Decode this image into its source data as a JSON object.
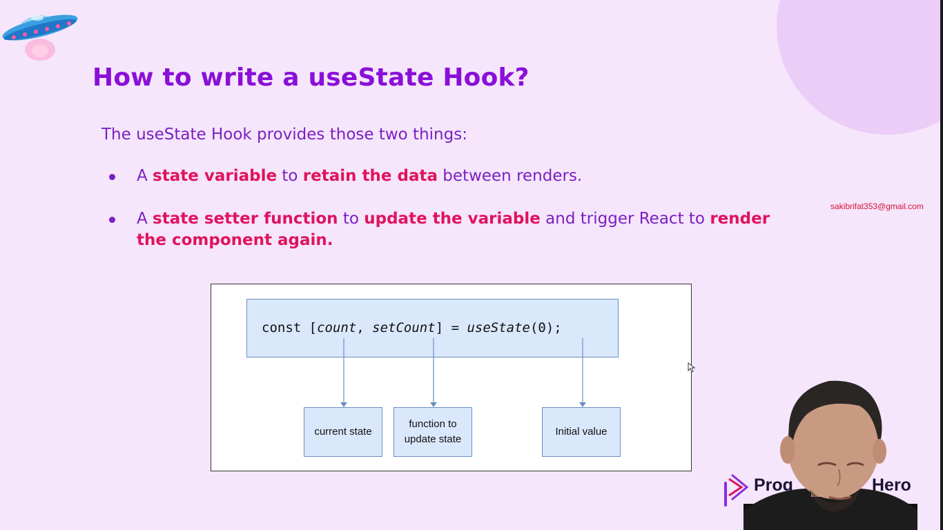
{
  "slide": {
    "title": "How to write a useState Hook?",
    "intro": "The useState Hook provides those two things:",
    "bullets": [
      {
        "parts": [
          "A ",
          "state variable",
          " to ",
          "retain the data",
          " between renders."
        ]
      },
      {
        "parts": [
          "A ",
          "state setter function",
          " to ",
          "update the variable",
          " and trigger React to ",
          "render the component again",
          "."
        ]
      }
    ]
  },
  "overlay": {
    "email": "sakibrifat353@gmail.com"
  },
  "diagram": {
    "code": {
      "prefix": "const [",
      "var1": "count",
      "sep": ", ",
      "var2": "setCount",
      "mid": "] = ",
      "fn": "useState",
      "suffix": "(0);"
    },
    "labels": {
      "current_state": "current state",
      "setter_line1": "function to",
      "setter_line2": "update state",
      "initial_value": "Initial value"
    }
  },
  "brand": {
    "name_visible_left": "Prog",
    "name_visible_right": "Hero"
  },
  "colors": {
    "background": "#f5e6fb",
    "title": "#8a0fd8",
    "body_text": "#7a1fc4",
    "highlight": "#e0135d",
    "box_fill": "#dae8fc",
    "box_border": "#6c8ebf",
    "arrow": "#6c8ebf"
  },
  "icons": {
    "ufo": "ufo-icon",
    "bullet": "bullet-dot-icon",
    "cursor": "mouse-cursor-icon",
    "brand_logo": "programming-hero-logo"
  }
}
